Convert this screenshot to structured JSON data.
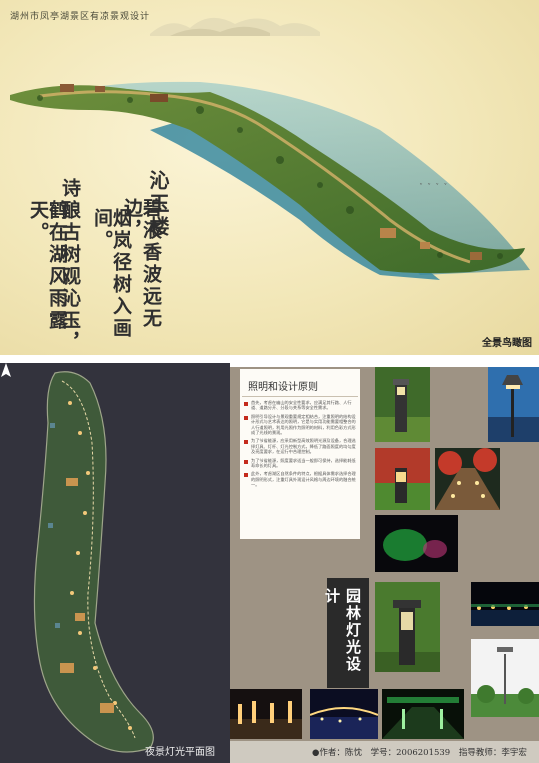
{
  "top_board": {
    "title": "湖州市凤亭湖景区有凉景观设计",
    "poem_title": "沁玉楼",
    "poem_lines": [
      "碧液香波远无边，",
      "烟岚径树入画间。",
      "诗酿古树观沁玉，",
      "鹤在湖风雨露天。"
    ],
    "aerial_label": "全景鸟瞰图"
  },
  "plan": {
    "label": "夜景灯光平面图"
  },
  "principles": {
    "title": "照明和设计原则",
    "items": [
      "首先，考虑在幽山的安全性要求，应满足其行路、人行道、道路分开、分段与关系等安全性需求。",
      "照明引导设计与景观重要规定相结合，注重照明的结构设计形式与艺术表达的照明，它是与实用功能需要相整合的人行道照明，利用光照作为照明的材料，利用色彩方式形成了光线的景观。",
      "为了节省能源，应采用新型高效照明光源及设备，合理选择灯具、灯杆、灯光控制方式，降低了路面照度的均匀度及亮度要求，在运行中合理控制。",
      "为了节省能源，照度要求适当一般即可保持，选择能耗低寿命长的灯具。",
      "此外，考虑湖区自然条件的特点，根据具体需求选择合理的照明形式，注重灯具外观设计风格与周边环境的融合统一。"
    ]
  },
  "section_title": "园林灯光设计",
  "author": {
    "author_text": "●作者：陈忱",
    "student_id_text": "学号：2006201539",
    "advisor_text": "指导教师：李宇宏"
  },
  "colors": {
    "paper": "#f5ebc2",
    "water": "#4f9cae",
    "plan_bg": "#33333d",
    "panel_bg": "#9e9384",
    "bullet_red": "#c42a1c"
  }
}
